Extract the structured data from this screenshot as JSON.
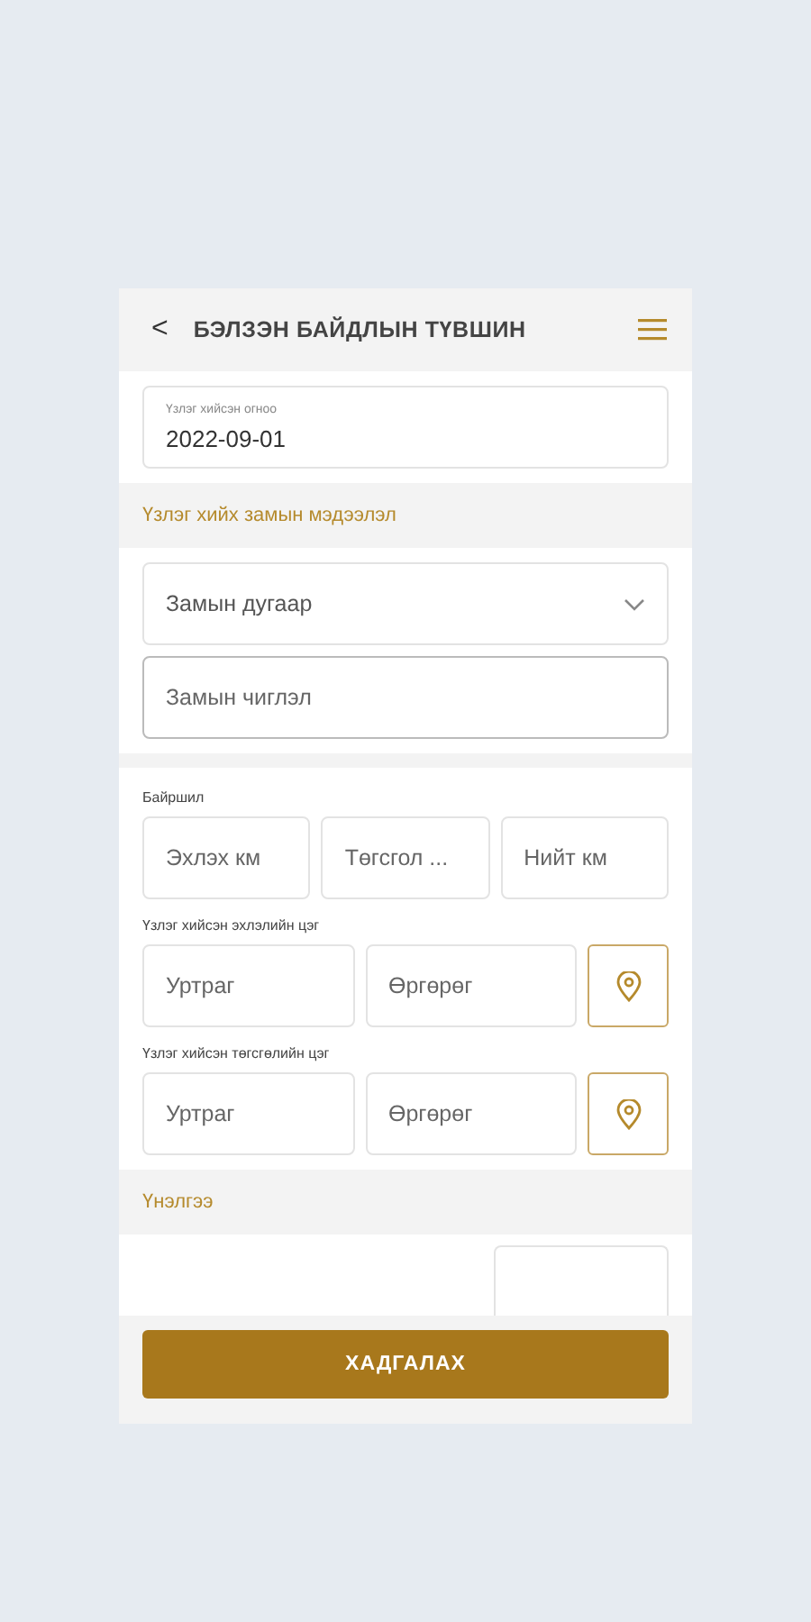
{
  "header": {
    "back": "<",
    "title": "БЭЛЗЭН БАЙДЛЫН ТҮВШИН"
  },
  "date_field": {
    "label": "Үзлэг хийсэн огноо",
    "value": "2022-09-01"
  },
  "road_section": {
    "heading": "Үзлэг хийх замын мэдээлэл",
    "road_number": {
      "placeholder": "Замын дугаар"
    },
    "road_direction": {
      "placeholder": "Замын чиглэл"
    }
  },
  "location": {
    "label": "Байршил",
    "fields": [
      {
        "placeholder": "Эхлэх км"
      },
      {
        "placeholder": "Төгсгол ..."
      },
      {
        "placeholder": "Нийт км"
      }
    ]
  },
  "points": [
    {
      "label": "Үзлэг хийсэн эхлэлийн цэг",
      "longitude": {
        "placeholder": "Уртраг"
      },
      "latitude": {
        "placeholder": "Өргөрөг"
      }
    },
    {
      "label": "Үзлэг хийсэн төгсгөлийн цэг",
      "longitude": {
        "placeholder": "Уртраг"
      },
      "latitude": {
        "placeholder": "Өргөрөг"
      }
    }
  ],
  "rating": {
    "heading": "Үнэлгээ"
  },
  "save_button": "ХАДГАЛАХ"
}
